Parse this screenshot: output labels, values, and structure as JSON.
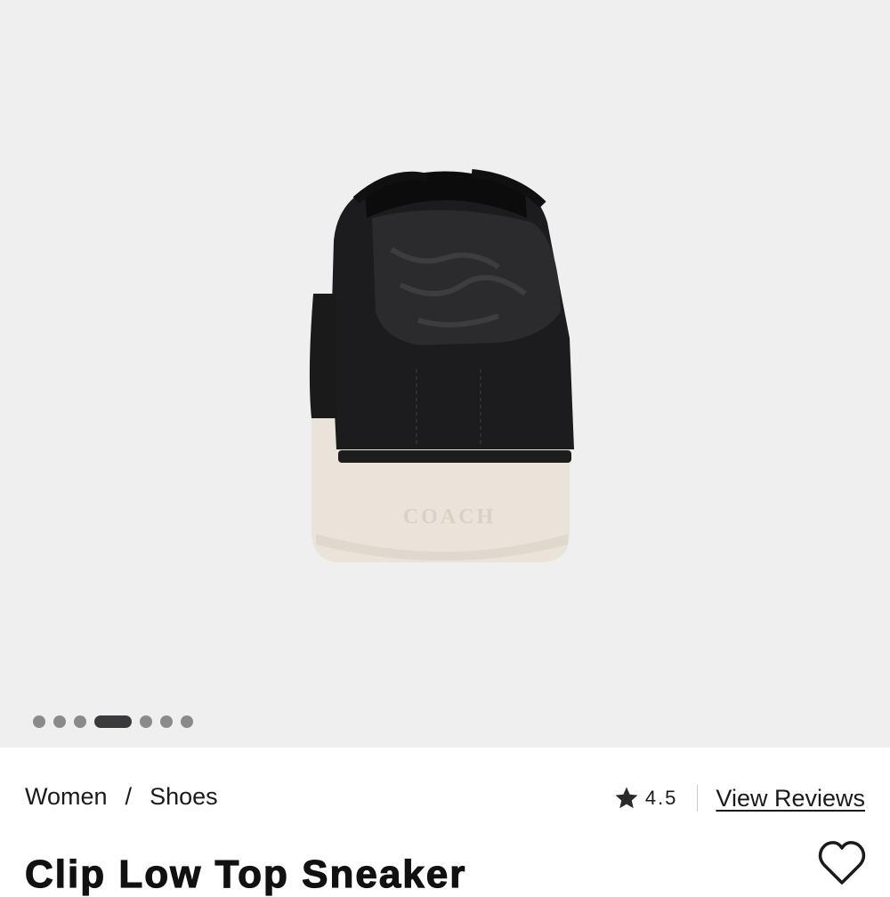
{
  "gallery": {
    "image_alt": "Clip Low Top Sneaker rear view",
    "slide_count": 7,
    "active_slide_index": 3,
    "image_brand_mark": "COACH"
  },
  "breadcrumb": {
    "items": [
      "Women",
      "Shoes"
    ],
    "separator": "/"
  },
  "rating": {
    "icon": "star-icon",
    "value": "4.5",
    "reviews_link": "View Reviews"
  },
  "product": {
    "title": "Clip Low Top Sneaker"
  },
  "wishlist": {
    "icon": "heart-outline-icon"
  },
  "colors": {
    "background": "#efeff0",
    "text": "#1a1a1a",
    "dot_inactive": "#8a8a8c",
    "dot_active": "#3a3a3c"
  }
}
